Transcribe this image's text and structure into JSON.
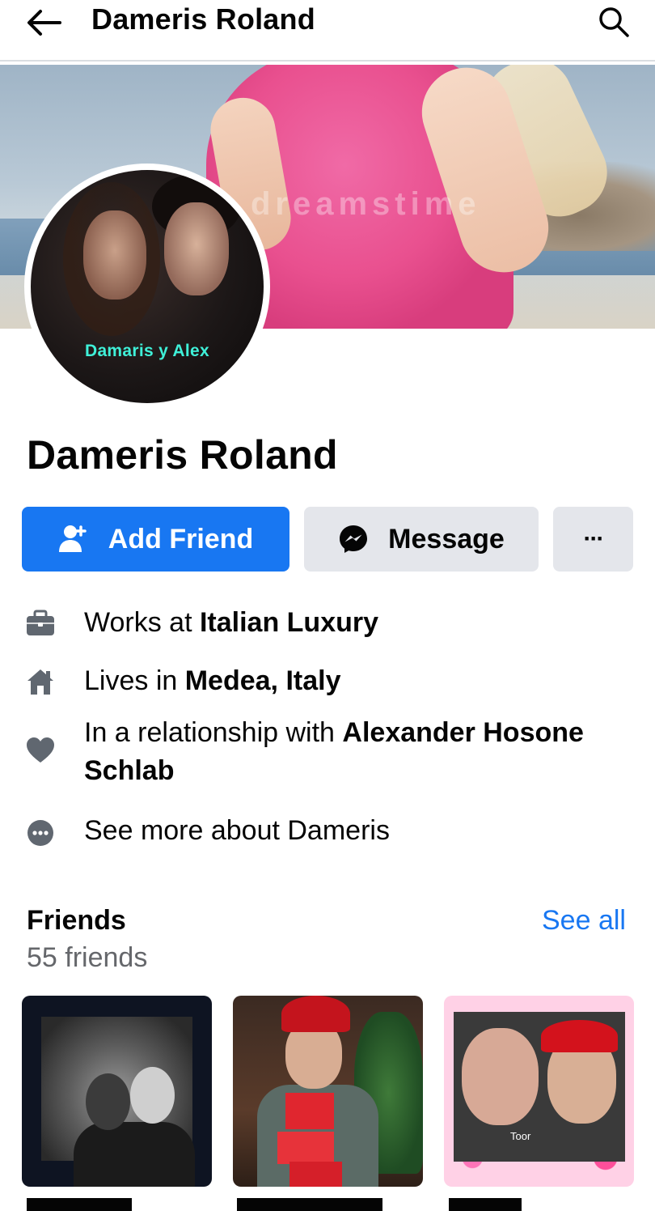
{
  "topbar": {
    "title": "Dameris Roland"
  },
  "cover": {
    "watermark": "dreamstime"
  },
  "profile": {
    "avatar_caption": "Damaris y Alex",
    "name": "Dameris Roland"
  },
  "actions": {
    "add_friend": "Add Friend",
    "message": "Message",
    "more": "···"
  },
  "about": {
    "work_prefix": "Works at ",
    "work_place": "Italian Luxury",
    "home_prefix": "Lives in ",
    "home_place": "Medea, Italy",
    "relationship_prefix": "In a relationship with ",
    "relationship_partner": "Alexander Hosone Schlab",
    "see_more": "See more about Dameris"
  },
  "friends": {
    "title": "Friends",
    "count": "55 friends",
    "see_all": "See all",
    "card3_caption": "Toor"
  },
  "colors": {
    "primary": "#1877f2",
    "secondary_button": "#e4e6eb",
    "muted_text": "#65676b",
    "icon_gray": "#606770"
  }
}
